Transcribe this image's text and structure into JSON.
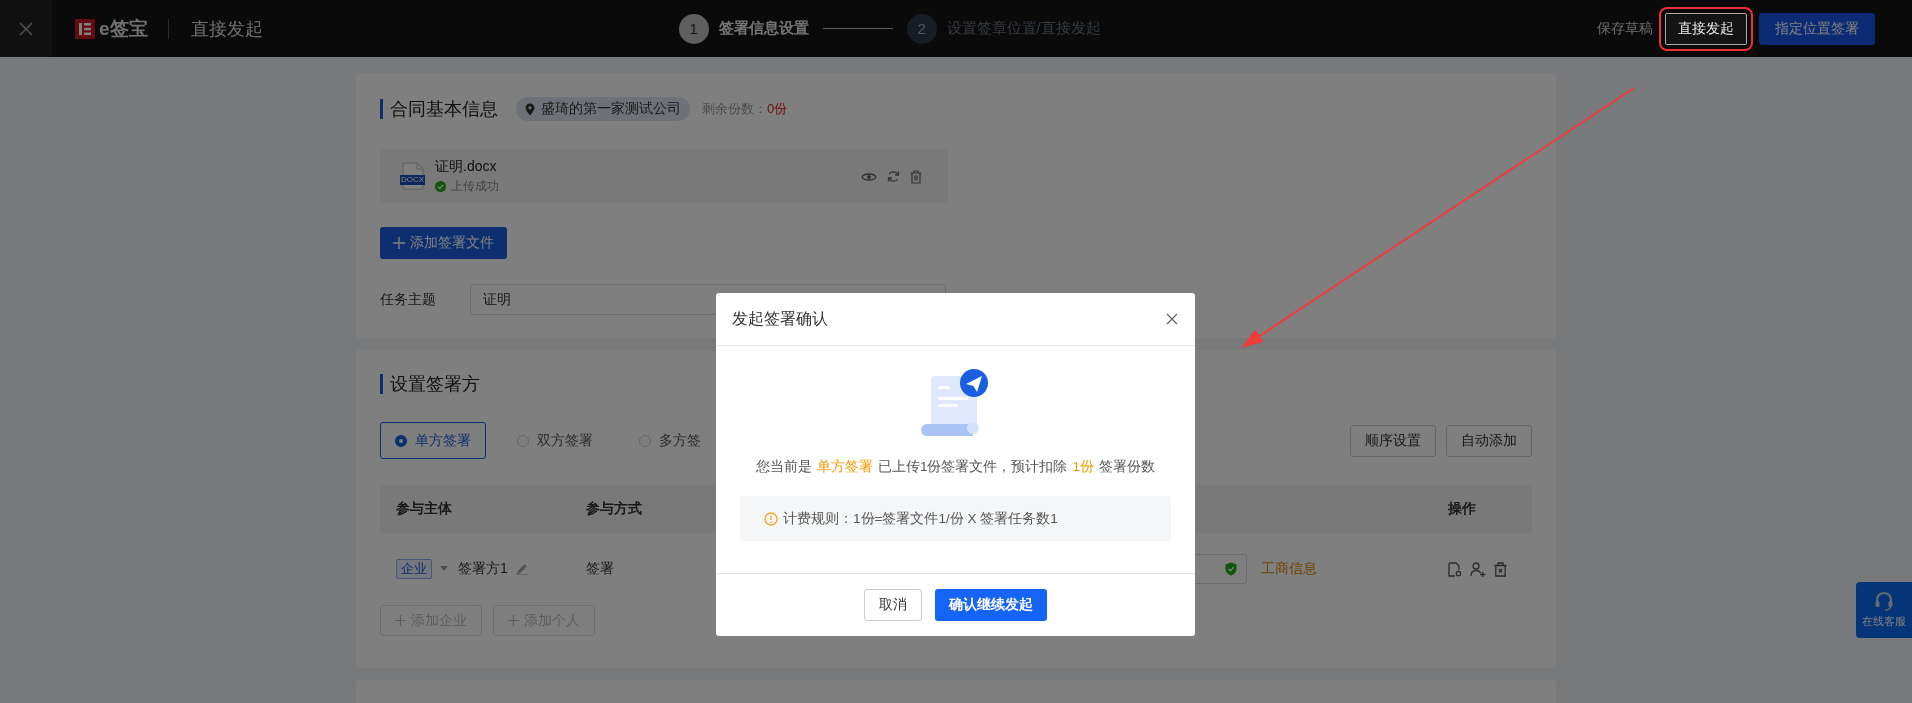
{
  "topbar": {
    "brand": "e签宝",
    "page_title": "直接发起",
    "steps": [
      {
        "number": "1",
        "label": "签署信息设置",
        "selected": true
      },
      {
        "number": "2",
        "label": "设置签章位置/直接发起",
        "selected": false
      }
    ],
    "actions": [
      {
        "kind": "link",
        "label": "保存草稿",
        "annotated": false
      },
      {
        "kind": "outline",
        "label": "直接发起",
        "annotated": true
      },
      {
        "kind": "primary",
        "label": "指定位置签署",
        "annotated": false
      }
    ]
  },
  "pointer_arrow": true,
  "contract_card": {
    "title": "合同基本信息",
    "company": "盛琦的第一家测试公司",
    "quota_label": "剩余份数：",
    "quota_value": "0份",
    "files": [
      {
        "name": "证明.docx",
        "type_label": "DOCX",
        "status": "上传成功"
      }
    ],
    "add_file_button": "添加签署文件",
    "subject_label": "任务主题",
    "subject_value": "证明"
  },
  "signers_card": {
    "title": "设置签署方",
    "modes": [
      {
        "label": "单方签署",
        "selected": true
      },
      {
        "label": "双方签署",
        "selected": false
      },
      {
        "label": "多方签",
        "selected": false
      }
    ],
    "buttons": [
      "顺序设置",
      "自动添加"
    ],
    "columns": [
      "参与主体",
      "参与方式",
      "操作"
    ],
    "rows": [
      {
        "entity_type": "企业",
        "name": "签署方1",
        "method": "签署",
        "verify_link": "工商信息"
      }
    ],
    "add_buttons": [
      {
        "label": "添加企业",
        "disabled": true
      },
      {
        "label": "添加个人",
        "disabled": true
      }
    ]
  },
  "modal": {
    "title": "发起签署确认",
    "message_parts": [
      {
        "text": "您当前是",
        "highlight": false
      },
      {
        "text": "单方签署",
        "highlight": true
      },
      {
        "text": "已上传1份签署文件，预计扣除",
        "highlight": false
      },
      {
        "text": "1份",
        "highlight": true
      },
      {
        "text": "签署份数",
        "highlight": false
      }
    ],
    "rule": "计费规则：1份=签署文件1/份 X 签署任务数1",
    "cancel": "取消",
    "confirm": "确认继续发起"
  },
  "help_button": {
    "label": "在线客服"
  }
}
